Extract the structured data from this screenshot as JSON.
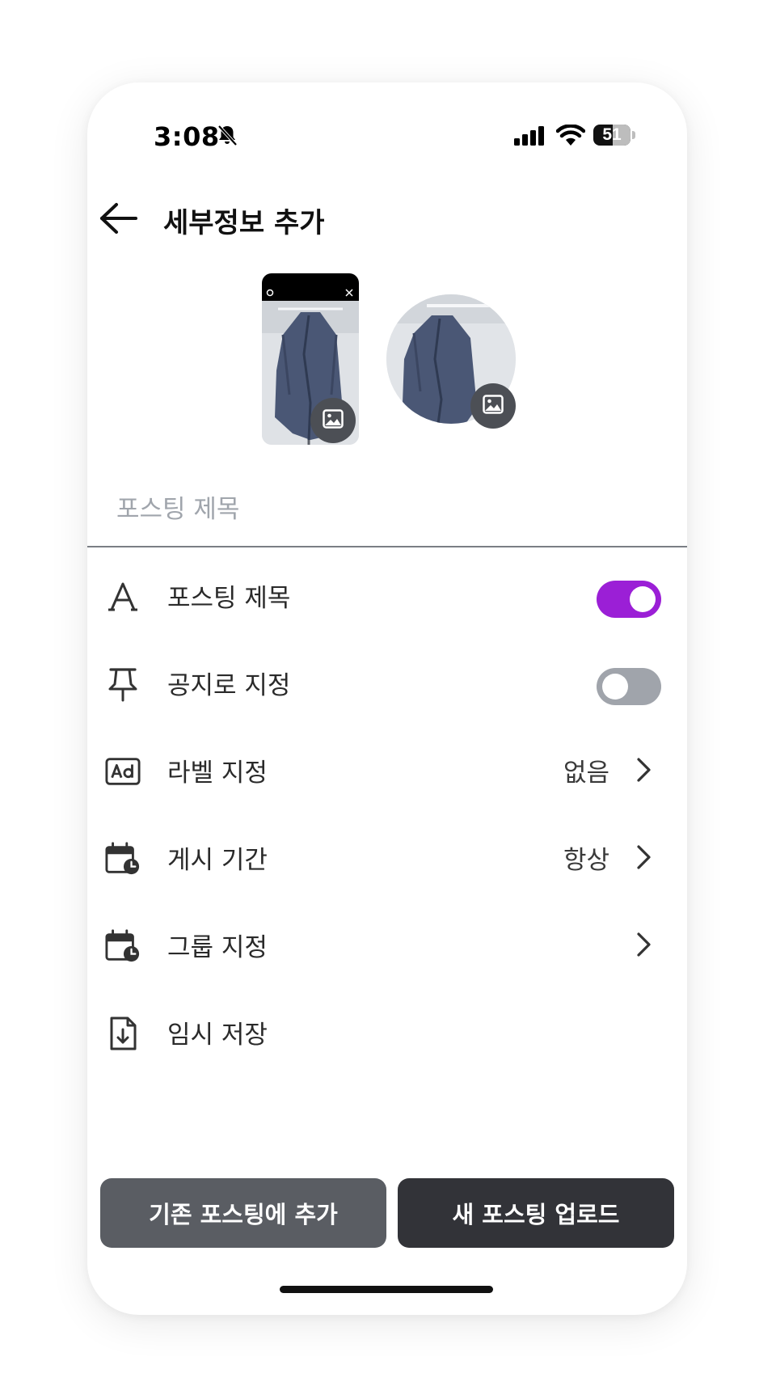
{
  "status_bar": {
    "time": "3:08",
    "battery": "51",
    "icons": [
      "bell-slash-icon",
      "cellular-signal-icon",
      "wifi-icon",
      "battery-icon"
    ]
  },
  "header": {
    "title": "세부정보 추가",
    "back_icon": "arrow-left-icon"
  },
  "media": {
    "thumbnail_icon": "image-icon",
    "cover_icon": "image-icon"
  },
  "title_input": {
    "placeholder": "포스팅 제목",
    "value": ""
  },
  "settings": [
    {
      "icon": "text-a-icon",
      "label": "포스팅 제목",
      "control": "toggle",
      "enabled": true
    },
    {
      "icon": "pin-icon",
      "label": "공지로 지정",
      "control": "toggle",
      "enabled": false
    },
    {
      "icon": "ad-label-icon",
      "label": "라벨 지정",
      "value": "없음",
      "control": "chevron"
    },
    {
      "icon": "calendar-clock-icon",
      "label": "게시 기간",
      "value": "항상",
      "control": "chevron"
    },
    {
      "icon": "calendar-clock-icon",
      "label": "그룹 지정",
      "value": "",
      "control": "chevron"
    },
    {
      "icon": "file-download-icon",
      "label": "임시 저장",
      "control": "none"
    }
  ],
  "buttons": {
    "add_existing": "기존 포스팅에 추가",
    "upload_new": "새 포스팅 업로드"
  },
  "colors": {
    "toggle_on": "#9b1fd6",
    "toggle_off": "#a0a4ab",
    "button_secondary": "#5a5d63",
    "button_primary": "#323338"
  }
}
